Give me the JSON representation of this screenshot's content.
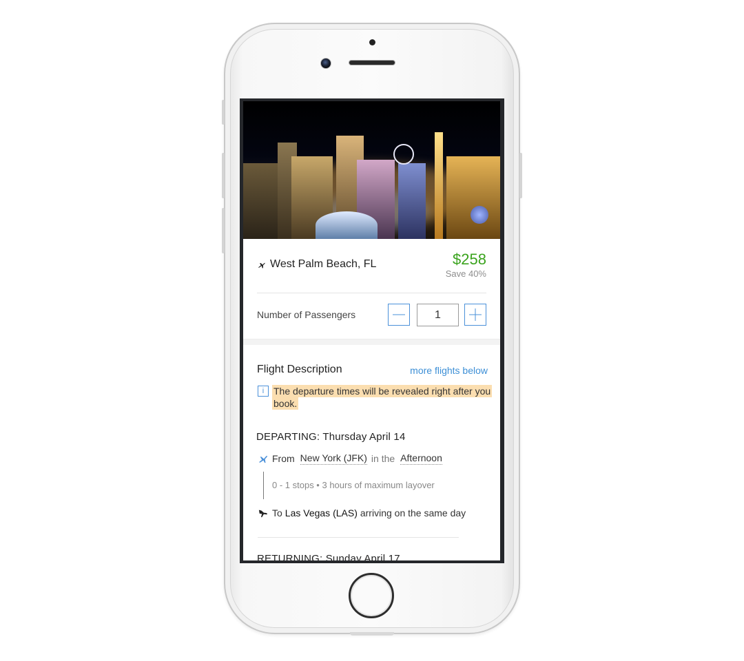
{
  "destination": {
    "name": "West Palm Beach, FL",
    "price": "$258",
    "savings": "Save 40%"
  },
  "passengers": {
    "label": "Number of Passengers",
    "count": "1"
  },
  "flight_description": {
    "title": "Flight Description",
    "more_link": "more flights below",
    "info_icon": "i",
    "notice": "The departure times will be revealed right after you book."
  },
  "departing": {
    "title": "DEPARTING: Thursday April 14",
    "from_label": "From",
    "from_airport": "New York (JFK)",
    "in_the": "in the",
    "time_of_day": "Afternoon",
    "stops_info": "0 - 1 stops • 3 hours of maximum layover",
    "to_label": "To",
    "to_airport": "Las Vegas (LAS)",
    "arrival_note": "arriving on the same day"
  },
  "returning": {
    "title": "RETURNING: Sunday April 17"
  },
  "icons": {
    "destination": "plane-icon",
    "takeoff": "takeoff-icon",
    "landing": "landing-icon",
    "minus": "minus-icon",
    "plus": "plus-icon",
    "info": "info-icon"
  },
  "colors": {
    "price": "#3aa31d",
    "accent": "#4a90d9",
    "highlight": "#fbdeb0",
    "link": "#3d8fd6"
  }
}
